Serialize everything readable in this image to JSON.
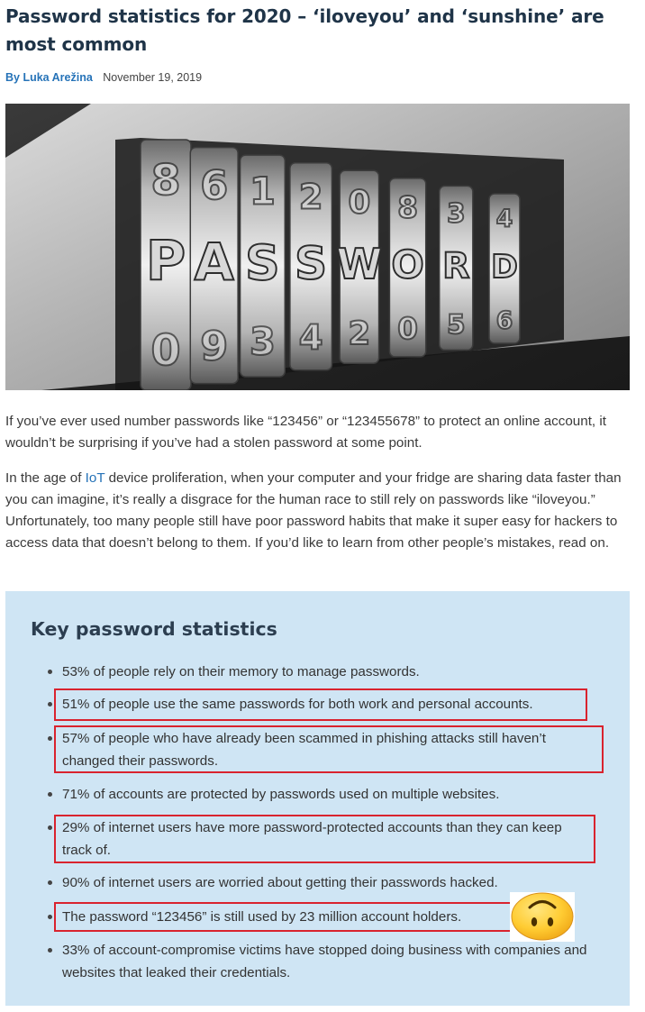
{
  "article": {
    "title": "Password statistics for 2020 – ‘iloveyou’ and ‘sunshine’ are most common",
    "author": "By Luka Arežina",
    "date": "November 19, 2019"
  },
  "hero_image": {
    "icon": "password-combination-lock",
    "top_row": [
      "8",
      "6",
      "1",
      "2",
      "0",
      "8",
      "3",
      "4"
    ],
    "word": [
      "P",
      "A",
      "S",
      "S",
      "W",
      "O",
      "R",
      "D"
    ],
    "bottom_row": [
      "0",
      "9",
      "3",
      "4",
      "2",
      "0",
      "5",
      "6"
    ]
  },
  "intro": {
    "p1": "If you’ve ever used number passwords like “123456” or “123455678” to protect an online account, it wouldn’t be surprising if you’ve had a stolen password at some point.",
    "p2_before": "In the age of ",
    "p2_link": "IoT",
    "p2_after": " device proliferation, when your computer and your fridge are sharing data faster than you can imagine, it’s really a disgrace for the human race to still rely on passwords like “iloveyou.” Unfortunately, too many people still have poor password habits that make it super easy for hackers to access data that doesn’t belong to them. If you’d like to learn from other people’s mistakes, read on."
  },
  "key_stats": {
    "heading": "Key password statistics",
    "items": [
      "53% of people rely on their memory to manage passwords.",
      "51% of people use the same passwords for both work and personal accounts.",
      "57% of people who have already been scammed in phishing attacks still haven’t changed their passwords.",
      "71% of accounts are protected by passwords used on multiple websites.",
      "29% of internet users have more password-protected accounts than they can keep track of.",
      "90% of internet users are worried about getting their passwords hacked.",
      "The password “123456” is still used by 23 million account holders.",
      "33% of account-compromise victims have stopped doing business with companies and websites that leaked their credentials."
    ],
    "highlighted": [
      1,
      2,
      4,
      6
    ],
    "emoji": "upside-down-face-icon"
  },
  "colors": {
    "title": "#1f3448",
    "link": "#2673b8",
    "box_bg": "#cfe5f4",
    "highlight": "#d9232e"
  }
}
